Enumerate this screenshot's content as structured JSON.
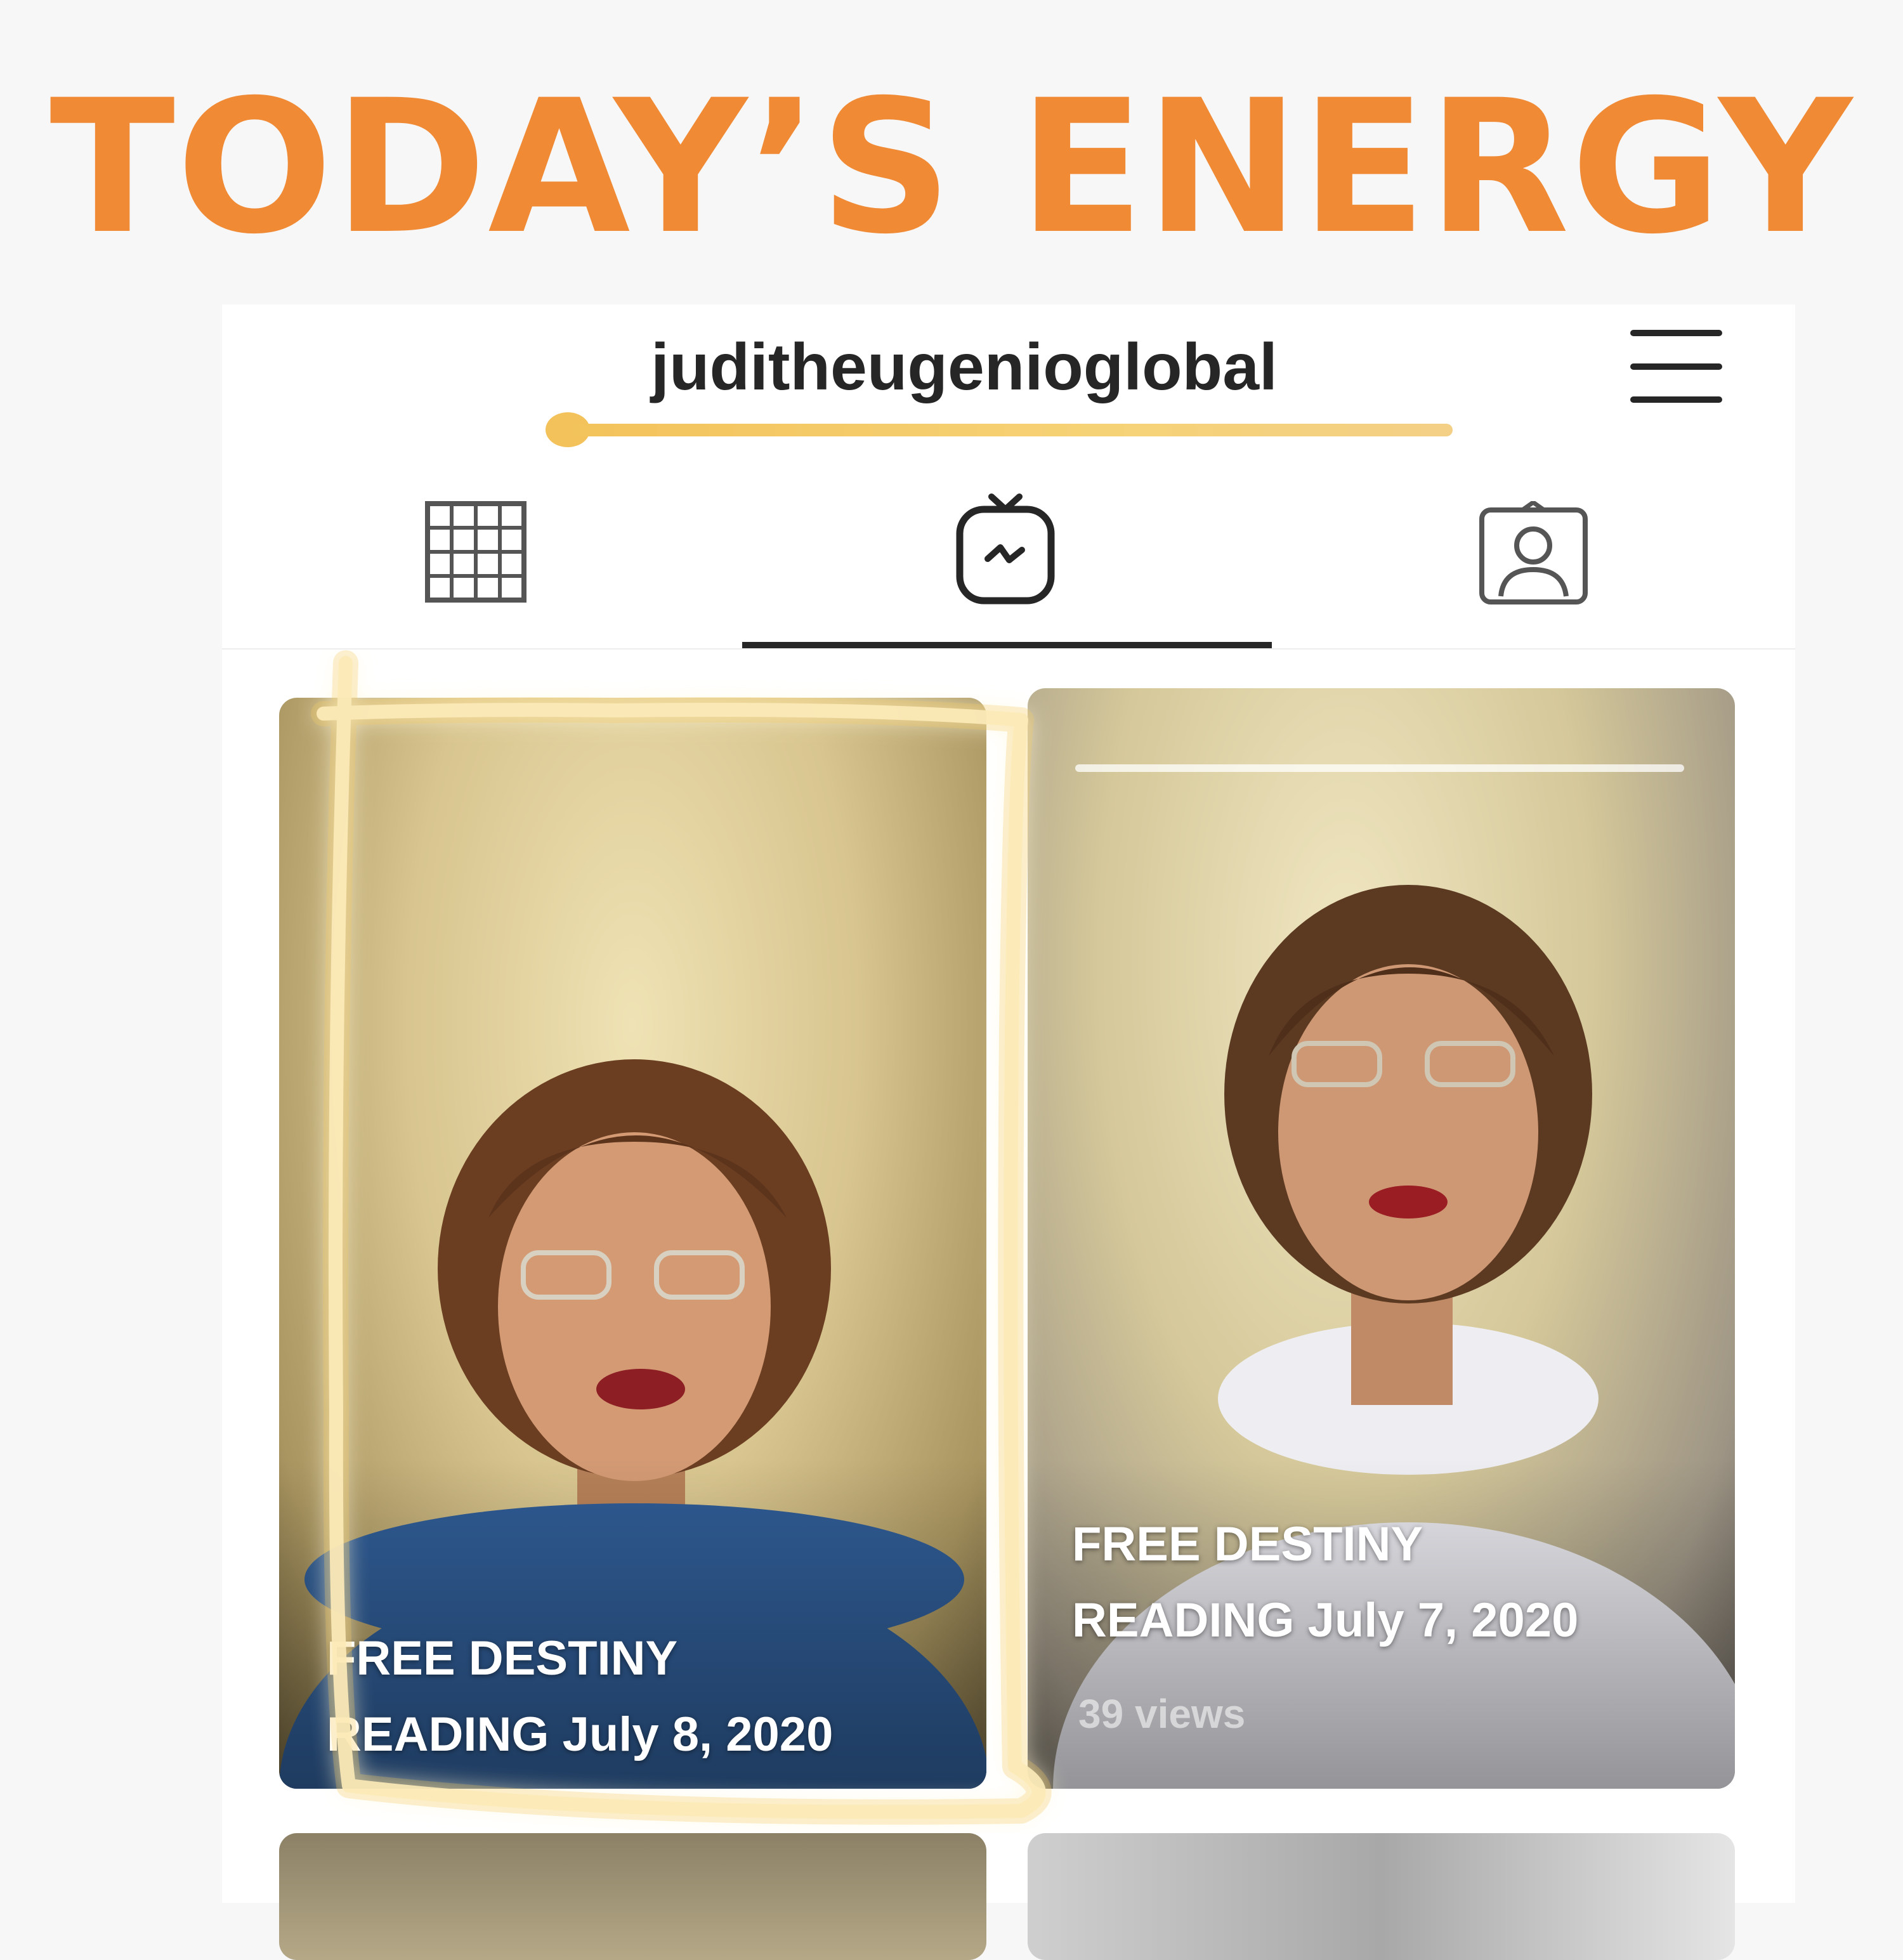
{
  "headline": "TODAY’S ENERGY",
  "profile": {
    "username": "juditheugenioglobal",
    "menu_icon": "hamburger-menu-icon"
  },
  "tabs": [
    {
      "icon": "grid-icon",
      "active": false
    },
    {
      "icon": "igtv-icon",
      "active": true
    },
    {
      "icon": "tagged-person-icon",
      "active": false
    }
  ],
  "videos": [
    {
      "title_line1": "FREE DESTINY",
      "title_line2": "READING July 8, 2020",
      "views": ""
    },
    {
      "title_line1": "FREE DESTINY",
      "title_line2": "READING July 7, 2020",
      "views": "39 views"
    }
  ],
  "colors": {
    "headline": "#f08a35",
    "underline": "#f3c25a",
    "highlight": "#f6d276",
    "text_dark": "#262626"
  }
}
